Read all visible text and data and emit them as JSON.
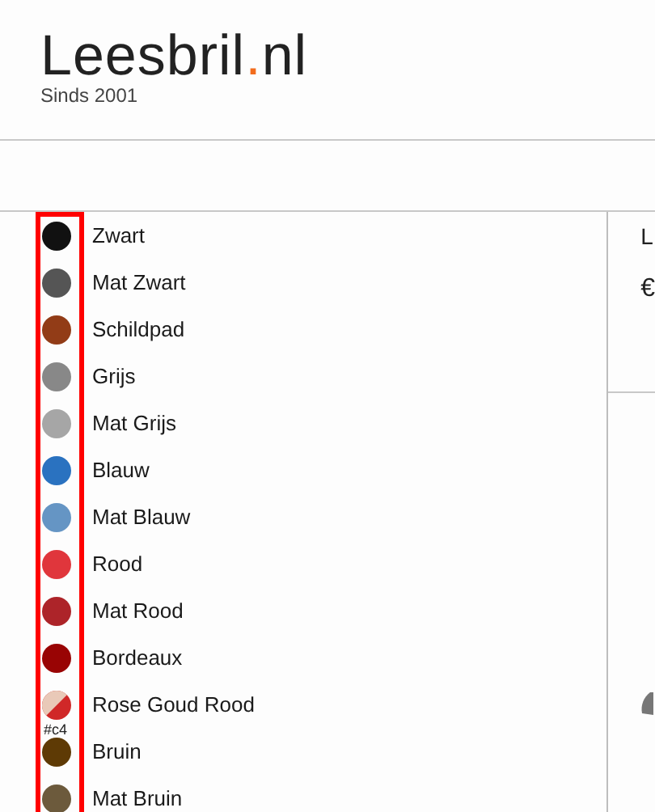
{
  "logo": {
    "name": "Leesbril",
    "dot": ".",
    "tld": "nl",
    "tagline": "Sinds 2001"
  },
  "colors": [
    {
      "label": "Zwart",
      "color": "#111111"
    },
    {
      "label": "Mat Zwart",
      "color": "#555555"
    },
    {
      "label": "Schildpad",
      "color": "#923c17"
    },
    {
      "label": "Grijs",
      "color": "#888888"
    },
    {
      "label": "Mat Grijs",
      "color": "#a6a6a6"
    },
    {
      "label": "Blauw",
      "color": "#2a72c0"
    },
    {
      "label": "Mat Blauw",
      "color": "#6595c4"
    },
    {
      "label": "Rood",
      "color": "#e0363c"
    },
    {
      "label": "Mat Rood",
      "color": "#ad2429"
    },
    {
      "label": "Bordeaux",
      "color": "#990404"
    },
    {
      "label": "Rose Goud Rood",
      "color": "#d02828",
      "kind": "split",
      "overflow": [
        "#",
        "c4"
      ]
    },
    {
      "label": "Bruin",
      "color": "#5e3a05"
    },
    {
      "label": "Mat Bruin",
      "color": "#6c5a3c"
    }
  ],
  "side_panel": {
    "title": "L",
    "price": "€"
  }
}
